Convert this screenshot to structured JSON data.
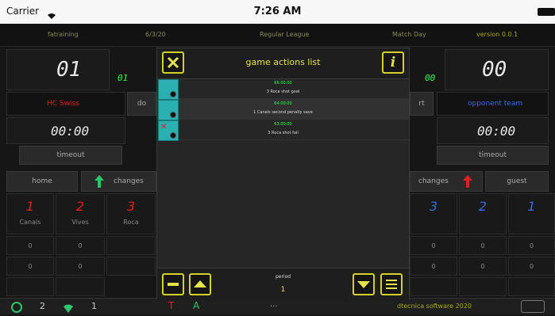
{
  "status": {
    "carrier": "Carrier",
    "time": "7:26 AM"
  },
  "info": {
    "team_short": "fatraining",
    "date": "6/3/20",
    "league": "Regular League",
    "match": "Match Day",
    "version": "version 0.0.1"
  },
  "home": {
    "score": "01",
    "small_score": "01",
    "name": "HC Swiss",
    "timer": "00:00",
    "timeout_label": "timeout",
    "label": "home",
    "changes_label": "changes"
  },
  "guest": {
    "score": "00",
    "small_score": "00",
    "name": "opponent team",
    "timer": "00:00",
    "timeout_label": "timeout",
    "label": "guest",
    "changes_label": "changes"
  },
  "players_left": [
    {
      "num": "1",
      "name": "Canals"
    },
    {
      "num": "2",
      "name": "Vives"
    },
    {
      "num": "3",
      "name": "Roca"
    }
  ],
  "players_right": [
    {
      "num": "3"
    },
    {
      "num": "2"
    },
    {
      "num": "1"
    }
  ],
  "zero": "0",
  "modal": {
    "title": "game actions list",
    "close_icon": "close-x-icon",
    "info_icon": "info-i-icon",
    "actions": [
      {
        "time": "66:00:00",
        "text": "3 Roca shot goal",
        "color": "#2cff4e"
      },
      {
        "time": "64:00:00",
        "text": "1 Canals second penalty save",
        "color": "#2cff4e"
      },
      {
        "time": "63:00:00",
        "text": "3 Roca shot fail",
        "color": "#2cff4e"
      }
    ],
    "period_label": "period",
    "period_value": "1"
  },
  "footer": {
    "copyright": "dtecnica software 2020",
    "counts": [
      "2",
      "1"
    ],
    "letters": [
      "T",
      "A"
    ],
    "dots": "..."
  },
  "colors": {
    "accent": "#d2d22a",
    "lcd_green": "#2cff4e",
    "tile": "#2ab0b0"
  }
}
